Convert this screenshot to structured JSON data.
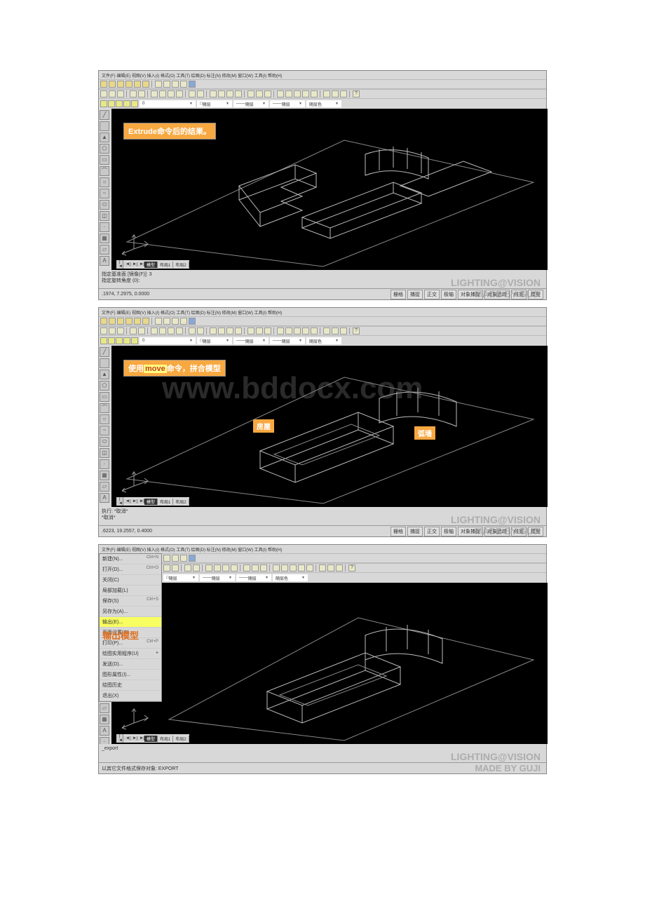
{
  "menubar_text": "文件(F) 编辑(E) 视图(V) 插入(I) 格式(O) 工具(T) 绘图(D) 标注(N) 修改(M) 窗口(W) 工具(I) 帮助(H)",
  "propbar": {
    "layer": "0",
    "linetype_label": "随层",
    "lineweight_label": "随层",
    "color_label": "随层色"
  },
  "status_buttons": [
    "栅格",
    "捕捉",
    "正交",
    "极轴",
    "对象捕捉",
    "对象追踪",
    "线宽",
    "模型"
  ],
  "model_tabs": {
    "nav": [
      "|◄",
      "◄",
      "►",
      "►|"
    ],
    "tabs": [
      "模型",
      "布局1",
      "布局2"
    ]
  },
  "panel1": {
    "annotation": "Extrude命令后的结果。",
    "command_lines": [
      "指定基准面 [镜像(F)]: 3",
      "指定旋转角度 (0):"
    ],
    "coords": ".1974, 7.2975, 0.0000",
    "watermark_vision": "LIGHTING@VISION",
    "watermark_guji": "MADE BY GUJI"
  },
  "panel2": {
    "annotation_prefix": "使用",
    "annotation_cmd": "move",
    "annotation_suffix": "命令，拼合模型",
    "label_room": "房屋",
    "label_wall": "弧墙",
    "command_lines": [
      "执行: *取消*",
      "*取消*"
    ],
    "coords": ".6223, 19.2557, 0.4000",
    "watermark_vision": "LIGHTING@VISION",
    "watermark_guji": "MADE BY GUJI",
    "watermark_big": "www.bddocx.com"
  },
  "panel3": {
    "export_annotation": "输出模型",
    "file_menu": [
      {
        "label": "新建(N)...",
        "shortcut": "Ctrl+N"
      },
      {
        "label": "打开(D)...",
        "shortcut": "Ctrl+O"
      },
      {
        "label": "关闭(C)",
        "shortcut": ""
      },
      {
        "label": "局部加载(L)",
        "shortcut": ""
      },
      {
        "label": "保存(S)",
        "shortcut": "Ctrl+S"
      },
      {
        "label": "另存为(A)...",
        "shortcut": ""
      },
      {
        "label": "输出(E)...",
        "shortcut": "",
        "highlighted": true
      },
      {
        "label": "页面设置(G)...",
        "shortcut": ""
      },
      {
        "label": "打印(P)...",
        "shortcut": "Ctrl+P"
      },
      {
        "label": "绘图实用程序(U)",
        "shortcut": "▸"
      },
      {
        "label": "发送(D)...",
        "shortcut": ""
      },
      {
        "label": "图形属性(I)...",
        "shortcut": ""
      },
      {
        "label": "绘图历史",
        "shortcut": ""
      },
      {
        "label": "退出(X)",
        "shortcut": ""
      }
    ],
    "command_lines": [
      "_export"
    ],
    "status_line": "以其它文件格式保存对象: EXPORT",
    "watermark_vision": "LIGHTING@VISION",
    "watermark_guji": "MADE BY GUJI"
  }
}
